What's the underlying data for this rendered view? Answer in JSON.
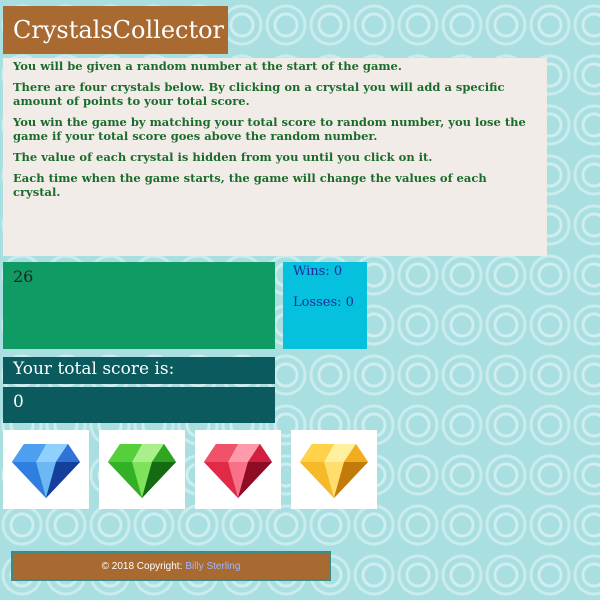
{
  "title": "CrystalsCollector",
  "instructions": [
    "You will be given a random number at the start of the game.",
    "There are four crystals below. By clicking on a crystal you will add a specific amount of points to your total score.",
    "You win the game by matching your total score to random number, you lose the game if your total score goes above the random number.",
    "The value of each crystal is hidden from you until you click on it.",
    "Each time when the game starts, the game will change the values of each crystal."
  ],
  "random_number": "26",
  "stats": {
    "wins": "Wins: 0",
    "losses": "Losses: 0"
  },
  "score": {
    "label": "Your total score is:",
    "value": "0"
  },
  "crystals": [
    {
      "name": "blue-crystal-icon",
      "color": "#2a6fd1"
    },
    {
      "name": "green-crystal-icon",
      "color": "#37b52a"
    },
    {
      "name": "red-crystal-icon",
      "color": "#e0324a"
    },
    {
      "name": "yellow-crystal-icon",
      "color": "#f4b523"
    }
  ],
  "footer": {
    "text": "© 2018 Copyright:",
    "link": "Billy Sterling"
  },
  "colors": {
    "title_bg": "#a86a30",
    "random_bg": "#0f9b63",
    "stats_bg": "#06c1dd",
    "score_bg": "#0a5a5e",
    "instructions_text": "#1a6b2c"
  }
}
